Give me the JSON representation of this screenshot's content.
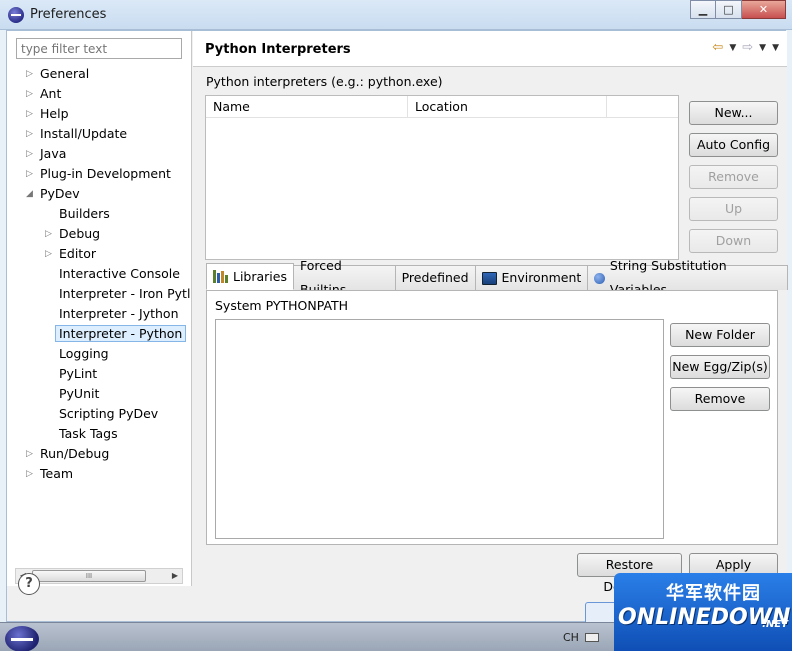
{
  "window": {
    "title": "Preferences",
    "minimize_glyph": "▁",
    "maximize_glyph": "□",
    "close_glyph": "✕"
  },
  "sidebar": {
    "filter_placeholder": "type filter text",
    "items": [
      {
        "label": "General",
        "level": 0,
        "expandable": true,
        "expanded": false
      },
      {
        "label": "Ant",
        "level": 0,
        "expandable": true,
        "expanded": false
      },
      {
        "label": "Help",
        "level": 0,
        "expandable": true,
        "expanded": false
      },
      {
        "label": "Install/Update",
        "level": 0,
        "expandable": true,
        "expanded": false
      },
      {
        "label": "Java",
        "level": 0,
        "expandable": true,
        "expanded": false
      },
      {
        "label": "Plug-in Development",
        "level": 0,
        "expandable": true,
        "expanded": false
      },
      {
        "label": "PyDev",
        "level": 0,
        "expandable": true,
        "expanded": true
      },
      {
        "label": "Builders",
        "level": 1,
        "expandable": false
      },
      {
        "label": "Debug",
        "level": 1,
        "expandable": true,
        "expanded": false
      },
      {
        "label": "Editor",
        "level": 1,
        "expandable": true,
        "expanded": false
      },
      {
        "label": "Interactive Console",
        "level": 1,
        "expandable": false
      },
      {
        "label": "Interpreter - Iron Pytl",
        "level": 1,
        "expandable": false
      },
      {
        "label": "Interpreter - Jython",
        "level": 1,
        "expandable": false
      },
      {
        "label": "Interpreter - Python",
        "level": 1,
        "expandable": false,
        "selected": true
      },
      {
        "label": "Logging",
        "level": 1,
        "expandable": false
      },
      {
        "label": "PyLint",
        "level": 1,
        "expandable": false
      },
      {
        "label": "PyUnit",
        "level": 1,
        "expandable": false
      },
      {
        "label": "Scripting PyDev",
        "level": 1,
        "expandable": false
      },
      {
        "label": "Task Tags",
        "level": 1,
        "expandable": false
      },
      {
        "label": "Run/Debug",
        "level": 0,
        "expandable": true,
        "expanded": false
      },
      {
        "label": "Team",
        "level": 0,
        "expandable": true,
        "expanded": false
      }
    ],
    "scroll_thumb_glyph": "III"
  },
  "page": {
    "title": "Python Interpreters",
    "interpreters_label": "Python interpreters (e.g.: python.exe)",
    "columns": [
      "Name",
      "Location"
    ],
    "side_buttons": {
      "new": "New...",
      "auto_config": "Auto Config",
      "remove": "Remove",
      "up": "Up",
      "down": "Down"
    },
    "tabs": [
      {
        "label": "Libraries",
        "icon": "libraries-icon",
        "active": true
      },
      {
        "label": "Forced Builtins",
        "icon": null,
        "active": false
      },
      {
        "label": "Predefined",
        "icon": null,
        "active": false
      },
      {
        "label": "Environment",
        "icon": "environment-icon",
        "active": false
      },
      {
        "label": "String Substitution Variables",
        "icon": "string-variables-icon",
        "active": false
      }
    ],
    "libraries": {
      "system_label": "System PYTHONPATH",
      "buttons": {
        "new_folder": "New Folder",
        "new_egg": "New Egg/Zip(s)",
        "remove": "Remove"
      }
    },
    "restore_defaults": "Restore Defaults",
    "apply": "Apply"
  },
  "footer": {
    "help_glyph": "?"
  },
  "taskbar": {
    "ime_label": "CH"
  },
  "watermark": {
    "chinese": "华军软件园",
    "english": "ONLINEDOWN",
    "suffix": ".NET"
  },
  "colors": {
    "selection_bg": "#ddeeff",
    "selection_border": "#86b5e8",
    "watermark_blue": "#1f67d1"
  }
}
